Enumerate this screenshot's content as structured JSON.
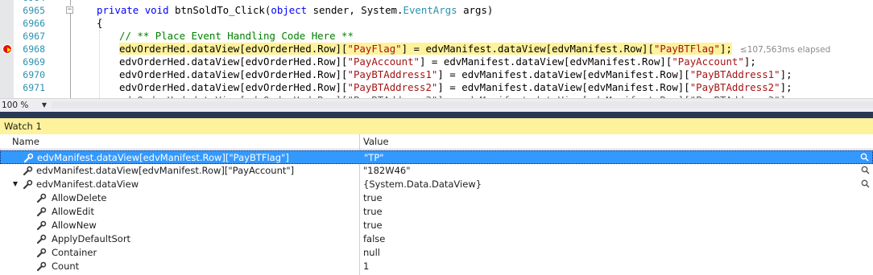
{
  "editor": {
    "line_numbers": [
      "6965",
      "6966",
      "6967",
      "6968",
      "6969",
      "6970",
      "6971"
    ],
    "lines": {
      "l6965": {
        "kw1": "private",
        "kw2": "void",
        "name": " btnSoldTo_Click(",
        "kw3": "object",
        "mid": " sender, System.",
        "type": "EventArgs",
        "end": " args)"
      },
      "l6966": {
        "text": "{"
      },
      "l6967": {
        "comment": "// ** Place Event Handling Code Here **"
      },
      "l6968": {
        "a": "edvOrderHed.dataView[edvOrderHed.Row][",
        "s1": "\"PayFlag\"",
        "b": "] = edvManifest.dataView[edvManifest.Row][",
        "s2": "\"PayBTFlag\"",
        "c": "];",
        "elapsed": "≤107,563ms elapsed"
      },
      "l6969": {
        "a": "edvOrderHed.dataView[edvOrderHed.Row][",
        "s1": "\"PayAccount\"",
        "b": "] = edvManifest.dataView[edvManifest.Row][",
        "s2": "\"PayAccount\"",
        "c": "];"
      },
      "l6970": {
        "a": "edvOrderHed.dataView[edvOrderHed.Row][",
        "s1": "\"PayBTAddress1\"",
        "b": "] = edvManifest.dataView[edvManifest.Row][",
        "s2": "\"PayBTAddress1\"",
        "c": "];"
      },
      "l6971": {
        "a": "edvOrderHed.dataView[edvOrderHed.Row][",
        "s1": "\"PayBTAddress2\"",
        "b": "] = edvManifest.dataView[edvManifest.Row][",
        "s2": "\"PayBTAddress2\"",
        "c": "];"
      }
    }
  },
  "zoom": {
    "value": "100 %"
  },
  "watch": {
    "title": "Watch 1",
    "columns": {
      "name": "Name",
      "value": "Value"
    },
    "rows": [
      {
        "name": "edvManifest.dataView[edvManifest.Row][\"PayBTFlag\"]",
        "value": "\"TP\""
      },
      {
        "name": "edvManifest.dataView[edvManifest.Row][\"PayAccount\"]",
        "value": "\"182W46\""
      },
      {
        "name": "edvManifest.dataView",
        "value": "{System.Data.DataView}"
      },
      {
        "name": "AllowDelete",
        "value": "true"
      },
      {
        "name": "AllowEdit",
        "value": "true"
      },
      {
        "name": "AllowNew",
        "value": "true"
      },
      {
        "name": "ApplyDefaultSort",
        "value": "false"
      },
      {
        "name": "Container",
        "value": "null"
      },
      {
        "name": "Count",
        "value": "1"
      }
    ]
  },
  "colors": {
    "highlight": "#fff29b",
    "selection": "#3399ff",
    "breakpoint": "#e51400"
  },
  "icons": {
    "breakpoint": "breakpoint-arrow-icon",
    "property": "wrench-icon",
    "search": "magnifier-icon",
    "expander": "expand-triangle-icon"
  }
}
